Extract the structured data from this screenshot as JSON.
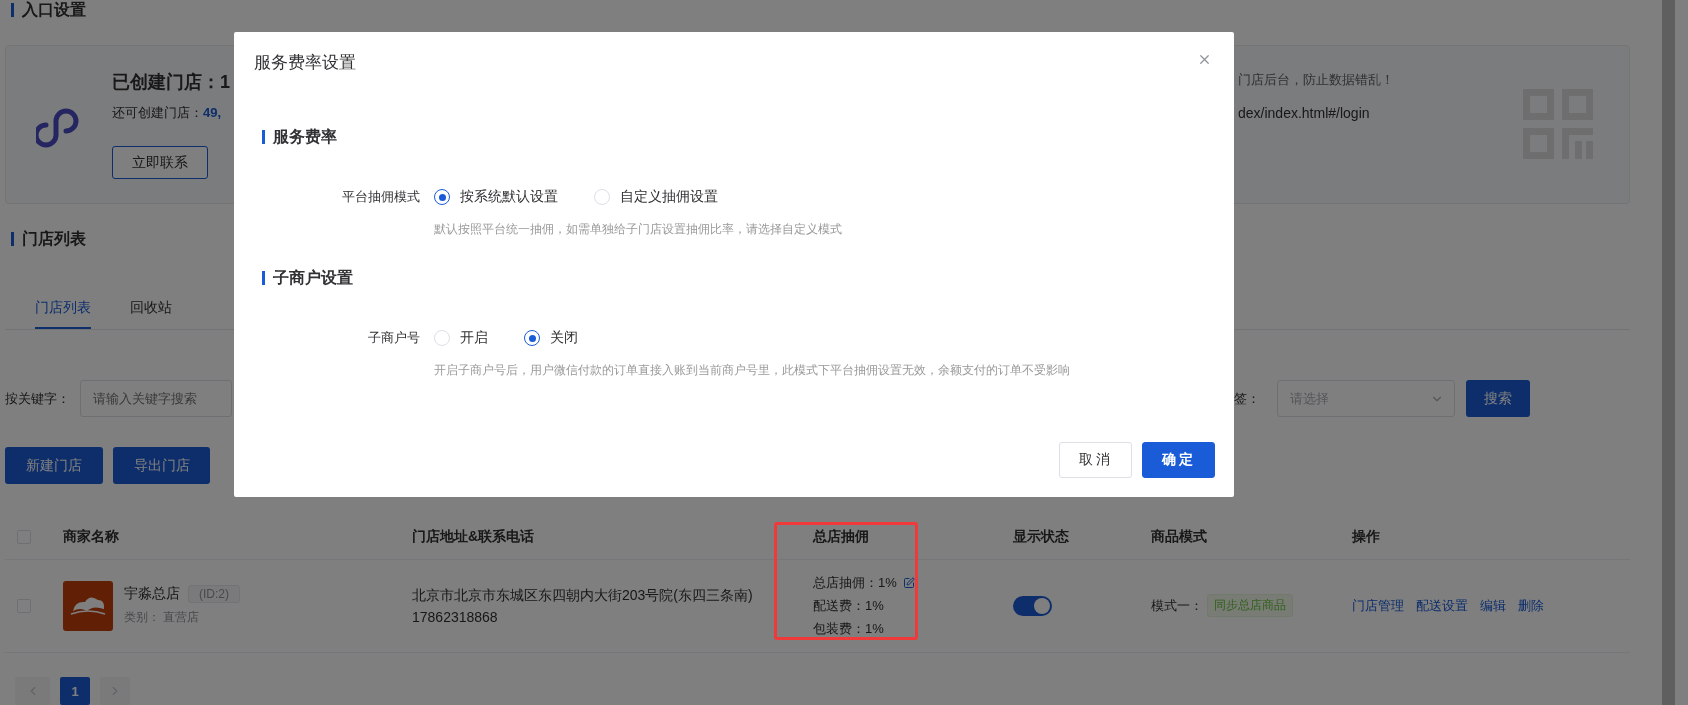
{
  "entry_section": {
    "heading": "入口设置",
    "card": {
      "created": "已创建门店：1",
      "remaining_label": "还可创建门店：",
      "remaining_value": "49,",
      "contact_button": "立即联系",
      "notice": "门店后台，防止数据错乱！",
      "url": "dex/index.html#/login"
    }
  },
  "store_section": {
    "heading": "门店列表",
    "tabs": [
      {
        "label": "门店列表",
        "selected": true
      },
      {
        "label": "回收站",
        "selected": false
      }
    ],
    "filters": {
      "keyword_label": "按关键字：",
      "keyword_placeholder": "请输入关键字搜索",
      "tag_label": "签：",
      "tag_placeholder": "请选择",
      "search_button": "搜索"
    },
    "actions": [
      "新建门店",
      "导出门店"
    ],
    "table": {
      "all_checked": false,
      "columns": [
        "商家名称",
        "门店地址&联系电话",
        "总店抽佣",
        "显示状态",
        "商品模式",
        "操作"
      ],
      "rows": [
        {
          "checked": false,
          "name": "宇淼总店",
          "id": "(ID:2)",
          "category": "类别： 直营店",
          "address": "北京市北京市东城区东四朝内大街203号院(东四三条南)",
          "phone": "17862318868",
          "fees": [
            "总店抽佣：1%",
            "配送费：1%",
            "包装费：1%"
          ],
          "visible": true,
          "mode": "模式一：",
          "mode_tag": "同步总店商品",
          "operations": [
            "门店管理",
            "配送设置",
            "编辑",
            "删除"
          ]
        }
      ]
    },
    "pagination": {
      "pages": [
        {
          "label": "1",
          "selected": true
        }
      ]
    }
  },
  "modal": {
    "title": "服务费率设置",
    "sections": [
      {
        "heading": "服务费率",
        "field": {
          "label": "平台抽佣模式",
          "options": [
            {
              "label": "按系统默认设置",
              "selected": true
            },
            {
              "label": "自定义抽佣设置",
              "selected": false
            }
          ],
          "hint": "默认按照平台统一抽佣，如需单独给子门店设置抽佣比率，请选择自定义模式"
        }
      },
      {
        "heading": "子商户设置",
        "field": {
          "label": "子商户号",
          "options": [
            {
              "label": "开启",
              "selected": false
            },
            {
              "label": "关闭",
              "selected": true
            }
          ],
          "hint": "开启子商户号后，用户微信付款的订单直接入账到当前商户号里，此模式下平台抽佣设置无效，余额支付的订单不受影响"
        }
      }
    ],
    "buttons": [
      {
        "label": "取消",
        "kind": "default"
      },
      {
        "label": "确定",
        "kind": "primary"
      }
    ]
  }
}
